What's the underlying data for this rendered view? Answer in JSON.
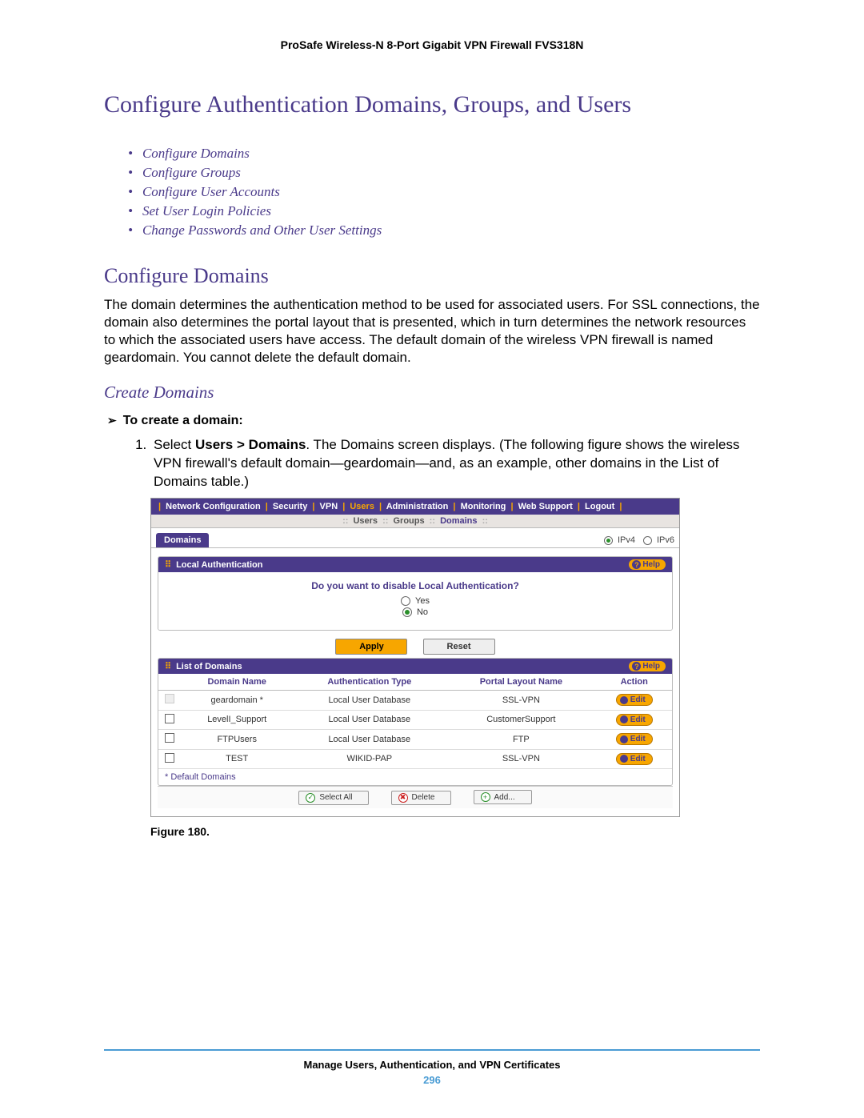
{
  "header": {
    "product_line": "ProSafe Wireless-N 8-Port Gigabit VPN Firewall FVS318N"
  },
  "title": "Configure Authentication Domains, Groups, and Users",
  "toc": {
    "items": [
      "Configure Domains",
      "Configure Groups",
      "Configure User Accounts",
      "Set User Login Policies",
      "Change Passwords and Other User Settings"
    ]
  },
  "section": {
    "heading": "Configure Domains",
    "body": "The domain determines the authentication method to be used for associated users. For SSL connections, the domain also determines the portal layout that is presented, which in turn determines the network resources to which the associated users have access. The default domain of the wireless VPN firewall is named geardomain. You cannot delete the default domain."
  },
  "sub": {
    "heading": "Create Domains",
    "step_lead": "To create a domain:",
    "step_1_prefix": "Select ",
    "step_1_bold": "Users > Domains",
    "step_1_rest": ". The Domains screen displays. (The following figure shows the wireless VPN firewall's default domain—geardomain—and, as an example, other domains in the List of Domains table.)"
  },
  "ui": {
    "top_menu": {
      "items": [
        "Network Configuration",
        "Security",
        "VPN",
        "Users",
        "Administration",
        "Monitoring",
        "Web Support",
        "Logout"
      ],
      "active": "Users"
    },
    "sub_menu": {
      "items": [
        "Users",
        "Groups",
        "Domains"
      ],
      "active": "Domains"
    },
    "tab": {
      "name": "Domains",
      "ipv4": "IPv4",
      "ipv6": "IPv6"
    },
    "local_auth": {
      "panel_title": "Local Authentication",
      "help_label": "Help",
      "question": "Do you want to disable Local Authentication?",
      "opt_yes": "Yes",
      "opt_no": "No",
      "apply_label": "Apply",
      "reset_label": "Reset"
    },
    "domains_panel": {
      "panel_title": "List of Domains",
      "help_label": "Help",
      "cols": {
        "domain": "Domain Name",
        "auth": "Authentication Type",
        "portal": "Portal Layout Name",
        "action": "Action"
      },
      "rows": [
        {
          "domain": "geardomain *",
          "auth": "Local User Database",
          "portal": "SSL-VPN",
          "edit": "Edit",
          "default": true
        },
        {
          "domain": "LevelI_Support",
          "auth": "Local User Database",
          "portal": "CustomerSupport",
          "edit": "Edit",
          "default": false
        },
        {
          "domain": "FTPUsers",
          "auth": "Local User Database",
          "portal": "FTP",
          "edit": "Edit",
          "default": false
        },
        {
          "domain": "TEST",
          "auth": "WIKID-PAP",
          "portal": "SSL-VPN",
          "edit": "Edit",
          "default": false
        }
      ],
      "default_note": "* Default Domains",
      "buttons": {
        "select_all": "Select All",
        "delete": "Delete",
        "add": "Add..."
      }
    }
  },
  "figure": {
    "caption": "Figure 180."
  },
  "footer": {
    "chapter": "Manage Users, Authentication, and VPN Certificates",
    "page": "296"
  }
}
